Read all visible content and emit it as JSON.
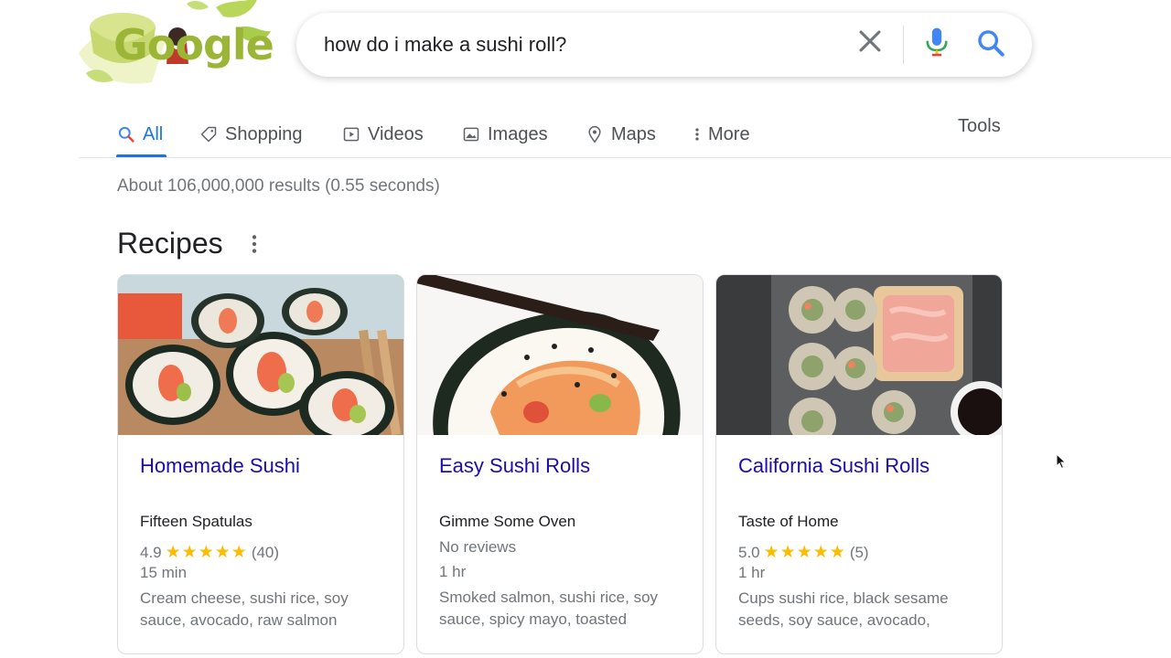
{
  "logo": {
    "text": "Google"
  },
  "search": {
    "query": "how do i make a sushi roll?"
  },
  "tabs": [
    {
      "label": "All",
      "icon": "search-icon"
    },
    {
      "label": "Shopping",
      "icon": "tag-icon"
    },
    {
      "label": "Videos",
      "icon": "play-icon"
    },
    {
      "label": "Images",
      "icon": "image-icon"
    },
    {
      "label": "Maps",
      "icon": "pin-icon"
    },
    {
      "label": "More",
      "icon": "more-vert-icon"
    }
  ],
  "tools_label": "Tools",
  "result_stats": "About 106,000,000 results (0.55 seconds)",
  "recipes": {
    "title": "Recipes",
    "cards": [
      {
        "title": "Homemade Sushi",
        "source": "Fifteen Spatulas",
        "rating": "4.9",
        "stars": "★★★★★",
        "reviews": "(40)",
        "time": "15 min",
        "ingredients": "Cream cheese, sushi rice, soy sauce, avocado, raw salmon"
      },
      {
        "title": "Easy Sushi Rolls",
        "source": "Gimme Some Oven",
        "reviews_text": "No reviews",
        "time": "1 hr",
        "ingredients": "Smoked salmon, sushi rice, soy sauce, spicy mayo, toasted"
      },
      {
        "title": "California Sushi Rolls",
        "source": "Taste of Home",
        "rating": "5.0",
        "stars": "★★★★★",
        "reviews": "(5)",
        "time": "1 hr",
        "ingredients": "Cups sushi rice, black sesame seeds, soy sauce, avocado,"
      }
    ]
  },
  "colors": {
    "accent": "#1a73e8",
    "link": "#1a0dab",
    "star": "#fbbc04",
    "muted": "#70757a"
  }
}
